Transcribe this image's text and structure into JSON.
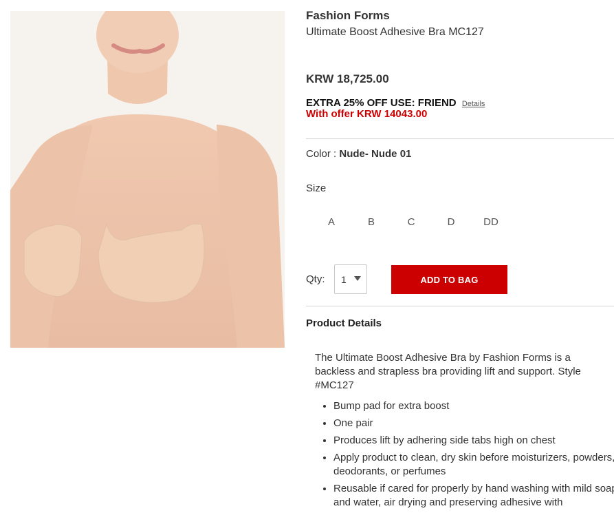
{
  "product": {
    "brand": "Fashion Forms",
    "name": "Ultimate Boost Adhesive Bra MC127",
    "price": "KRW 18,725.00",
    "promo_text": "EXTRA 25% OFF USE: FRIEND",
    "promo_details_link": "Details",
    "offer_text": "With offer KRW 14043.00",
    "color_label": "Color : ",
    "color_value": "Nude- Nude 01",
    "size_label": "Size",
    "sizes": [
      "A",
      "B",
      "C",
      "D",
      "DD"
    ],
    "qty_label": "Qty:",
    "qty_value": "1",
    "add_to_bag": "ADD TO BAG",
    "details_title": "Product Details",
    "description": "The Ultimate Boost Adhesive Bra by Fashion Forms is a backless and strapless bra providing lift and support. Style #MC127",
    "bullets": [
      "Bump pad for extra boost",
      "One pair",
      "Produces lift by adhering side tabs high on chest",
      "Apply product to clean, dry skin before moisturizers, powders, deodorants, or perfumes",
      "Reusable if cared for properly by hand washing with mild soap and water, air drying and preserving adhesive with"
    ]
  },
  "colors": {
    "accent": "#cc0000",
    "offer": "#cc0000",
    "text": "#333333",
    "divider": "#d4d4d4"
  }
}
